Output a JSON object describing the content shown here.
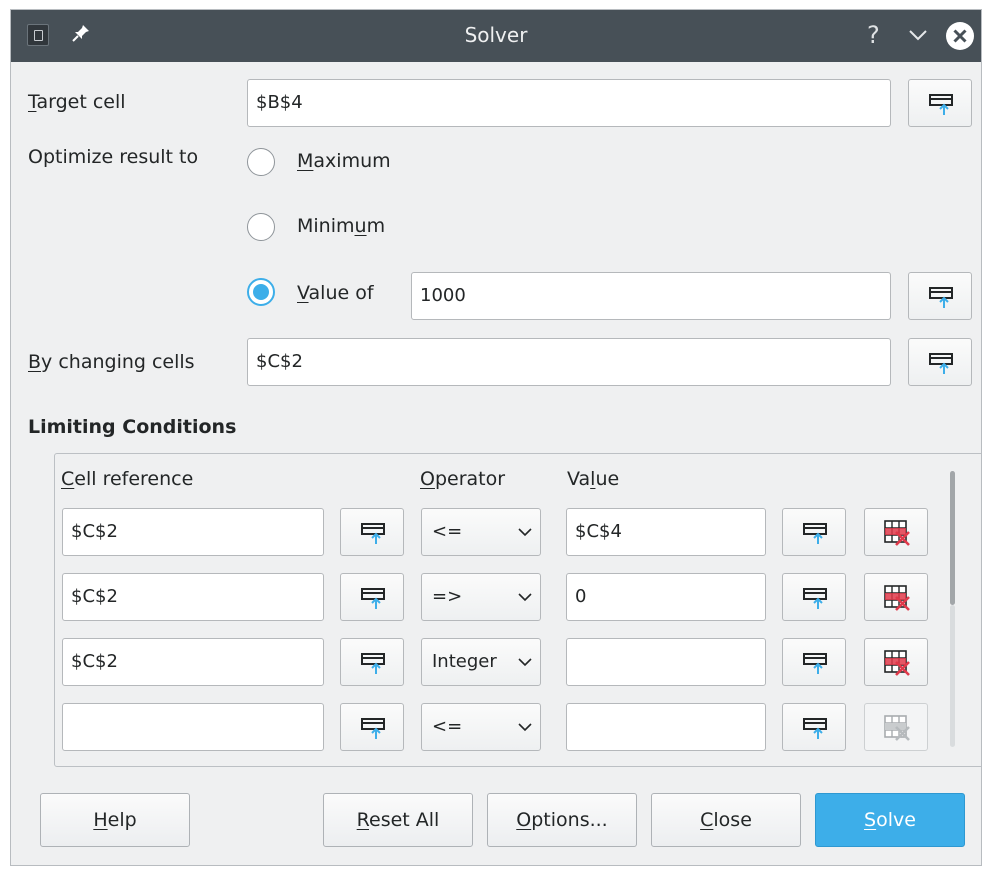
{
  "window": {
    "title": "Solver"
  },
  "target": {
    "label": "Target cell",
    "value": "$B$4"
  },
  "optimize": {
    "label": "Optimize result to",
    "maximum": "Maximum",
    "minimum": "Minimum",
    "value_of": "Value of",
    "value_of_value": "1000",
    "selected": "value_of"
  },
  "changing": {
    "label": "By changing cells",
    "value": "$C$2"
  },
  "limiting": {
    "title": "Limiting Conditions",
    "headers": {
      "cell": "Cell reference",
      "operator": "Operator",
      "value": "Value"
    },
    "rows": [
      {
        "cell": "$C$2",
        "operator": "<=",
        "value": "$C$4"
      },
      {
        "cell": "$C$2",
        "operator": "=>",
        "value": "0"
      },
      {
        "cell": "$C$2",
        "operator": "Integer",
        "value": ""
      },
      {
        "cell": "",
        "operator": "<=",
        "value": ""
      }
    ]
  },
  "buttons": {
    "help": "Help",
    "reset": "Reset All",
    "options": "Options...",
    "close": "Close",
    "solve": "Solve"
  },
  "icons": {
    "shrink": "shrink-icon",
    "delete": "delete-row-icon",
    "pin": "pin-icon",
    "help": "help-icon",
    "close": "close-icon"
  },
  "colors": {
    "accent": "#3daee9",
    "titlebar": "#475057",
    "delete_red": "#e0394a"
  }
}
